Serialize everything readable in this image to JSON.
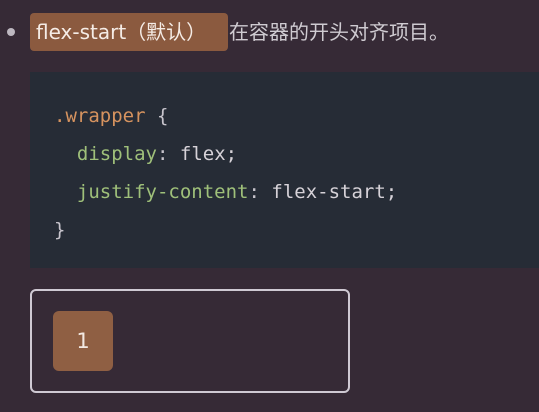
{
  "list_item": {
    "code_label": "flex-start（默认）",
    "description": "在容器的开头对齐项目。"
  },
  "code": {
    "selector": ".wrapper",
    "open_brace": " {",
    "display_prop": "display",
    "display_value": "flex;",
    "justify_prop": "justify-content",
    "justify_value": "flex-start;",
    "close_brace": "}",
    "colon": ":"
  },
  "demo": {
    "item_label": "1"
  },
  "colors": {
    "background": "#362a36",
    "inline_code_bg": "#8b5a3f",
    "code_block_bg": "#262c36",
    "selector": "#d6935f",
    "property": "#9fc07a",
    "flex_item": "#8f5f43"
  }
}
